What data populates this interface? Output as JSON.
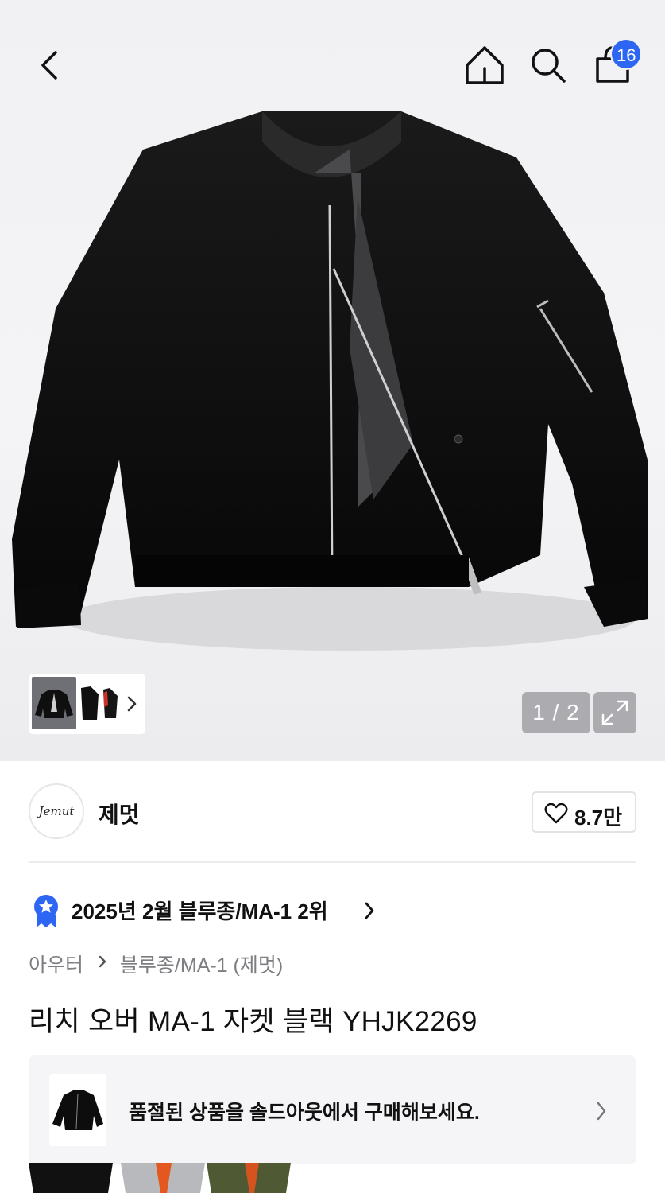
{
  "header": {
    "back_icon": "chevron-left-icon",
    "home_icon": "home-icon",
    "search_icon": "search-icon",
    "cart_icon": "shopping-bag-icon",
    "cart_count": "16",
    "badge_color": "#2d66f2"
  },
  "gallery": {
    "pager_text": "1 / 2",
    "expand_icon": "expand-icon",
    "thumb_next_icon": "chevron-right-icon"
  },
  "brand": {
    "logo_text": "Jemut",
    "name": "제멋",
    "like_icon": "heart-icon",
    "like_count": "8.7만"
  },
  "ranking": {
    "badge_icon": "star-badge-icon",
    "text": "2025년 2월 블루종/MA-1 2위",
    "chevron_icon": "chevron-right-icon",
    "badge_color": "#2d66f2"
  },
  "breadcrumb": {
    "category": "아우터",
    "subcategory": "블루종/MA-1 (제멋)"
  },
  "product": {
    "title": "리치 오버 MA-1 자켓 블랙 YHJK2269"
  },
  "soldout_notice": {
    "text": "품절된 상품을 솔드아웃에서 구매해보세요.",
    "chevron_icon": "chevron-right-icon"
  }
}
